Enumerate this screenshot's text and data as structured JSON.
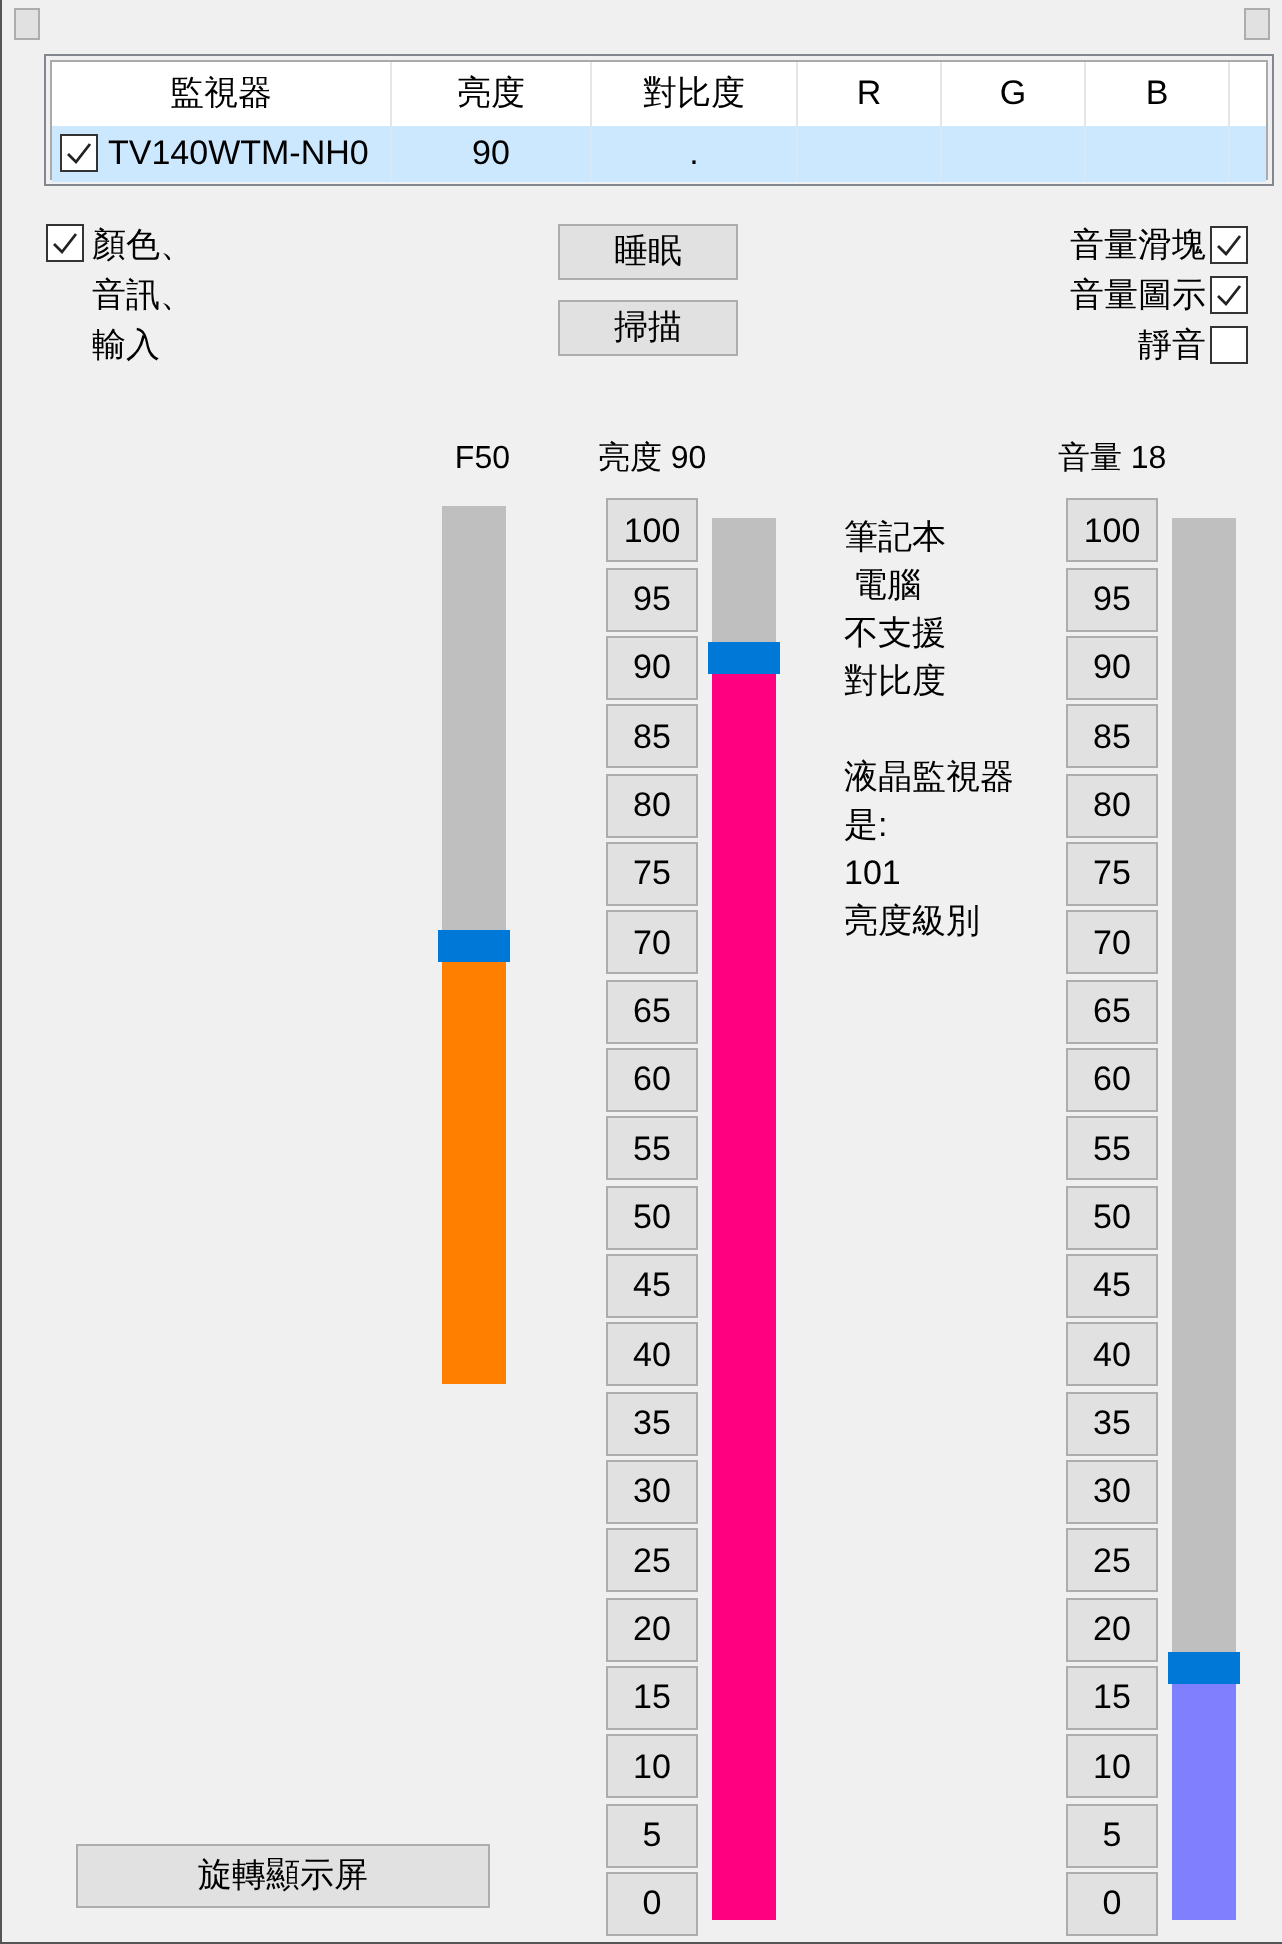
{
  "monitor_table": {
    "columns": [
      "監視器",
      "亮度",
      "對比度",
      "R",
      "G",
      "B"
    ],
    "rows": [
      {
        "checked": true,
        "selected": true,
        "monitor": "TV140WTM-NH0",
        "brightness": "90",
        "contrast": "."
      }
    ]
  },
  "options_checkbox": {
    "checked": true,
    "label_lines": [
      "顏色、",
      "音訊、",
      "輸入"
    ]
  },
  "buttons": [
    "睡眠",
    "掃描"
  ],
  "right_checkboxes": [
    {
      "label": "音量滑塊",
      "checked": true
    },
    {
      "label": "音量圖示",
      "checked": true
    },
    {
      "label": "靜音",
      "checked": false
    }
  ],
  "sliders": [
    {
      "kind": "plain",
      "label": "F50",
      "level": 0.5,
      "color": "#ff8000"
    },
    {
      "kind": "scaled",
      "label": "亮度 90",
      "level": 0.9,
      "color": "#ff0080",
      "scale": [
        "100",
        "95",
        "90",
        "85",
        "80",
        "75",
        "70",
        "65",
        "60",
        "55",
        "50",
        "45",
        "40",
        "35",
        "30",
        "25",
        "20",
        "15",
        "10",
        "5",
        "0"
      ]
    },
    {
      "kind": "scaled",
      "label": "音量 18",
      "level": 0.18,
      "color": "#8080ff",
      "scale": [
        "100",
        "95",
        "90",
        "85",
        "80",
        "75",
        "70",
        "65",
        "60",
        "55",
        "50",
        "45",
        "40",
        "35",
        "30",
        "25",
        "20",
        "15",
        "10",
        "5",
        "0"
      ]
    }
  ],
  "notes": [
    {
      "lines": [
        "筆記本",
        " 電腦",
        "不支援",
        "對比度"
      ]
    },
    {
      "lines": [
        "液晶監視器",
        "是:",
        "101",
        "亮度級別"
      ]
    }
  ],
  "rotate_button": "旋轉顯示屏"
}
